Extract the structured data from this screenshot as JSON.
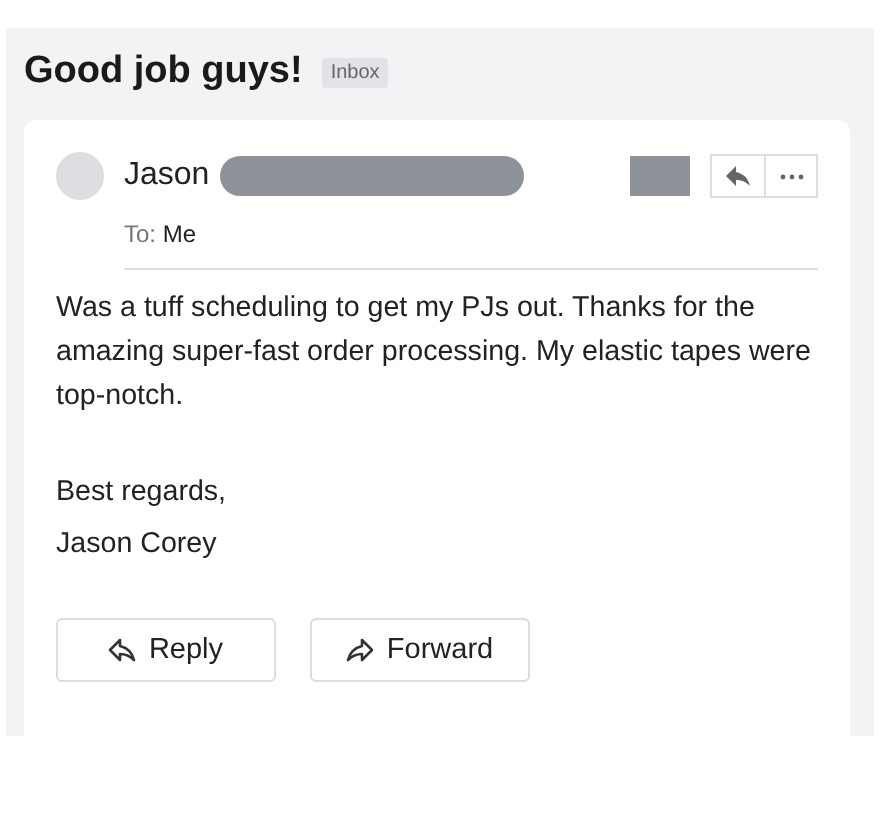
{
  "subject": "Good job guys!",
  "label": "Inbox",
  "sender": {
    "name": "Jason"
  },
  "recipient": {
    "label": "To:",
    "value": "Me"
  },
  "body": [
    "Was a tuff scheduling to get my PJs out. Thanks for the amazing super-fast order processing. My elastic tapes were top-notch."
  ],
  "signature": [
    "Best regards,",
    "Jason Corey"
  ],
  "buttons": [
    {
      "kind": "reply",
      "label": "Reply"
    },
    {
      "kind": "forward",
      "label": "Forward"
    }
  ]
}
